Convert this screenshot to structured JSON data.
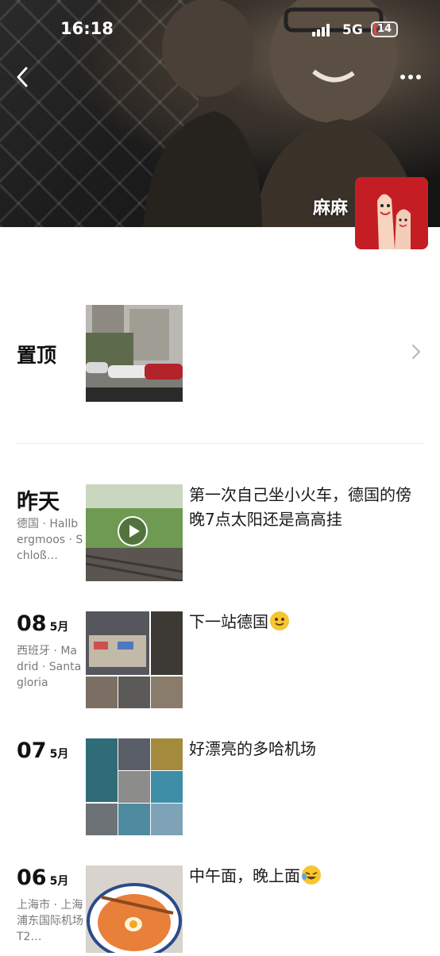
{
  "status_bar": {
    "time": "16:18",
    "network": "5G",
    "battery": "14",
    "battery_percent": 14
  },
  "header": {
    "owner_name": "麻麻",
    "back_icon": "chevron-left-icon",
    "more_icon": "more-dots-icon"
  },
  "pinned": {
    "label": "置顶",
    "chevron_icon": "chevron-right-icon"
  },
  "posts": [
    {
      "day": "昨天",
      "month": "",
      "location": "德国 · Hallbergmoos · Schloß…",
      "text": "第一次自己坐小火车，德国的傍晚7点太阳还是高高挂",
      "media": "video"
    },
    {
      "day": "08",
      "month": "5月",
      "location": "西班牙 · Madrid · Santagloria",
      "text": "下一站德国",
      "emoji": "smiling-face-emoji",
      "media": "photos"
    },
    {
      "day": "07",
      "month": "5月",
      "location": "",
      "text": "好漂亮的多哈机场",
      "media": "photos"
    },
    {
      "day": "06",
      "month": "5月",
      "location": "上海市 · 上海浦东国际机场 T2…",
      "text": "中午面，晚上面",
      "emoji": "laughing-tears-emoji",
      "media": "photo"
    }
  ],
  "colors": {
    "accent_battery": "#e0463f",
    "avatar_bg": "#c41e24",
    "location_text": "#7a7a7a"
  }
}
